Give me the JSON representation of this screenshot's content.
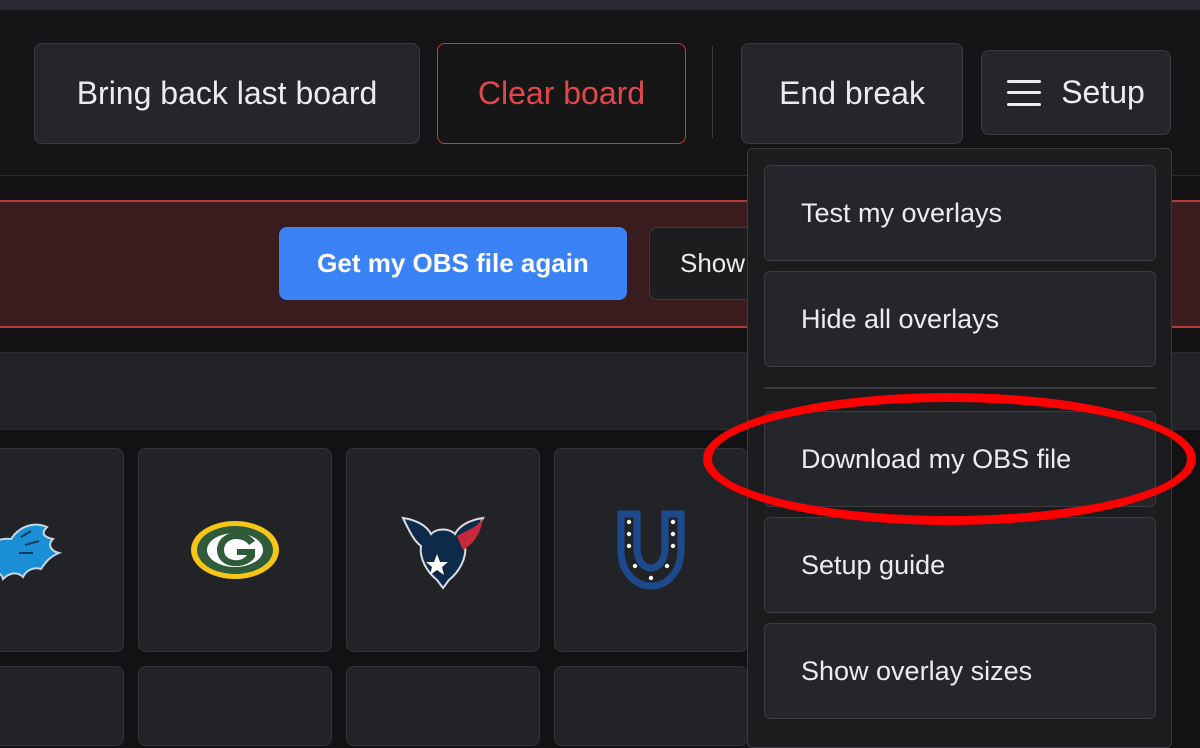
{
  "header": {
    "bring_back_label": "Bring back last board",
    "clear_board_label": "Clear board",
    "end_break_label": "End break",
    "setup_label": "Setup"
  },
  "alert": {
    "get_obs_label": "Get my OBS file again",
    "show_label": "Show"
  },
  "teams": [
    {
      "icon": "lions-logo-icon"
    },
    {
      "icon": "packers-logo-icon"
    },
    {
      "icon": "texans-logo-icon"
    },
    {
      "icon": "colts-logo-icon"
    }
  ],
  "setup_menu": {
    "items": [
      {
        "label": "Test my overlays"
      },
      {
        "label": "Hide all overlays"
      },
      {
        "label": "Download my OBS file"
      },
      {
        "label": "Setup guide"
      },
      {
        "label": "Show overlay sizes"
      }
    ]
  },
  "colors": {
    "accent_blue": "#3b82f6",
    "danger_red": "#e0484c",
    "annotation_red": "#ff0000",
    "background": "#121214"
  }
}
